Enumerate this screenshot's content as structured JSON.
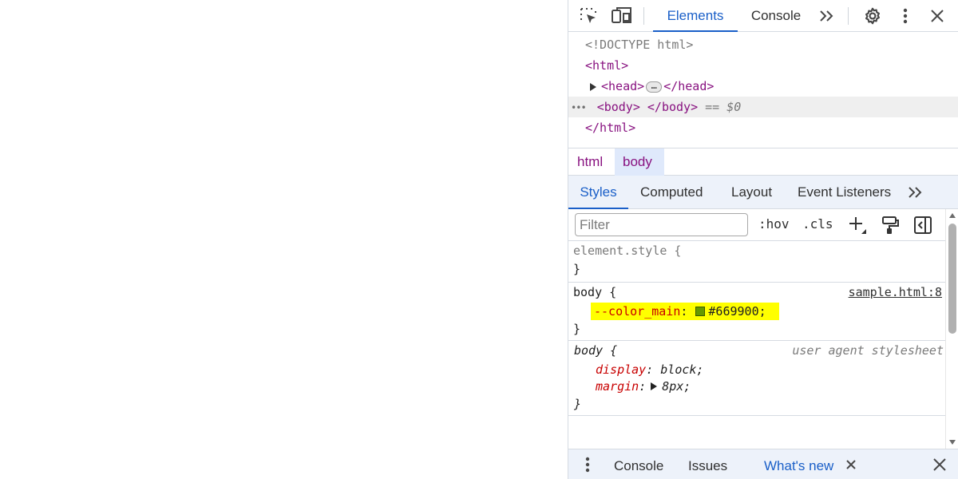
{
  "toolbar": {
    "tabs": [
      {
        "label": "Elements",
        "active": true
      },
      {
        "label": "Console",
        "active": false
      }
    ],
    "icons": [
      "inspect-element-icon",
      "device-toolbar-icon",
      "more-tabs-icon",
      "settings-gear-icon",
      "kebab-menu-icon",
      "close-icon"
    ]
  },
  "dom": {
    "doctype": "<!DOCTYPE html>",
    "html_open": "<html>",
    "head_open": "<head>",
    "head_ellipsis": "…",
    "head_close": "</head>",
    "body_open": "<body>",
    "body_close": "</body>",
    "selected_marker": "== $0",
    "row_dots": "•••",
    "html_close": "</html>"
  },
  "breadcrumb": {
    "items": [
      {
        "label": "html",
        "active": false
      },
      {
        "label": "body",
        "active": true
      }
    ]
  },
  "subtabs": {
    "items": [
      {
        "label": "Styles",
        "active": true
      },
      {
        "label": "Computed",
        "active": false
      },
      {
        "label": "Layout",
        "active": false
      },
      {
        "label": "Event Listeners",
        "active": false
      }
    ]
  },
  "filterbar": {
    "placeholder": "Filter",
    "hov": ":hov",
    "cls": ".cls"
  },
  "styles": {
    "element_style": {
      "selector": "element.style {",
      "close": "}"
    },
    "rule1": {
      "selector": "body {",
      "source": "sample.html:8",
      "prop": "--color_main",
      "colon": ":",
      "value": "#669900;",
      "close": "}"
    },
    "rule2": {
      "selector": "body {",
      "source": "user agent stylesheet",
      "prop1": "display",
      "value1": "block;",
      "prop2": "margin",
      "value2": "8px;",
      "colon": ":",
      "close": "}"
    }
  },
  "drawer": {
    "tabs": [
      {
        "label": "Console",
        "active": false
      },
      {
        "label": "Issues",
        "active": false
      },
      {
        "label": "What's new",
        "active": true
      }
    ]
  },
  "colors": {
    "accent": "#1a5fc8",
    "tag": "#881280",
    "property": "#c80000",
    "highlight": "#ffff00",
    "swatch": "#669900"
  }
}
